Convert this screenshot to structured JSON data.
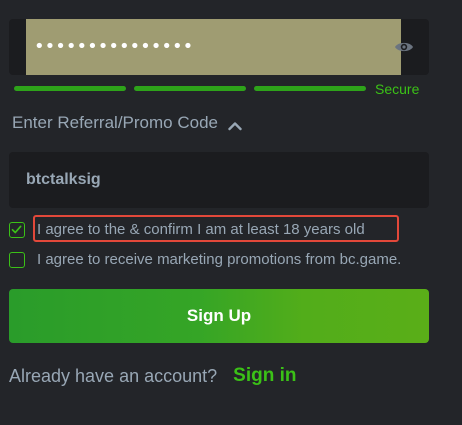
{
  "password": {
    "masked_value": "•••••••••••••••",
    "visibility_icon": "eye-icon"
  },
  "strength": {
    "segments_filled": 3,
    "segments_total": 3,
    "label": "Secure",
    "color": "#3bc117"
  },
  "referral": {
    "toggle_label": "Enter Referral/Promo Code",
    "toggle_icon": "chevron-up-icon",
    "value": "btctalksig"
  },
  "agreements": [
    {
      "label": "I agree to the & confirm I am at least 18 years old",
      "checked": true
    },
    {
      "label": "I agree to receive marketing promotions from bc.game.",
      "checked": false
    }
  ],
  "signup_button": {
    "label": "Sign Up"
  },
  "footer": {
    "prompt": "Already have an account?",
    "signin_label": "Sign in"
  },
  "colors": {
    "background": "#232529",
    "input_background": "#1b1c1f",
    "accent": "#3bc117",
    "text": "#98a7b5",
    "highlight": "#e2483a"
  }
}
